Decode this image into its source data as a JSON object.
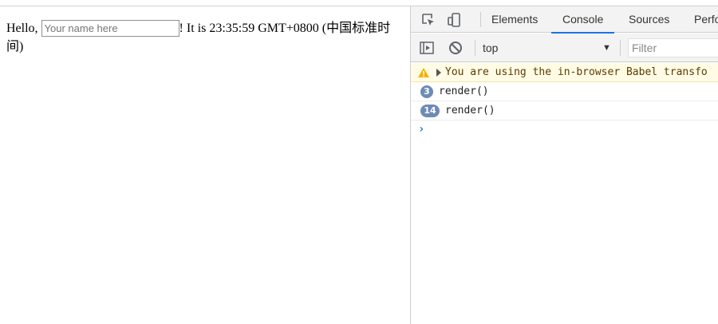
{
  "page": {
    "greeting_prefix": "Hello, ",
    "name_input_placeholder": "Your name here",
    "time_text": "! It is 23:35:59 GMT+0800 (中国标准时间)"
  },
  "devtools": {
    "tabs": [
      {
        "label": "Elements",
        "active": false
      },
      {
        "label": "Console",
        "active": true
      },
      {
        "label": "Sources",
        "active": false
      },
      {
        "label": "Perfo",
        "active": false
      }
    ],
    "toolbar": {
      "context": "top",
      "filter_placeholder": "Filter"
    },
    "console": {
      "warning": "You are using the in-browser Babel transfo",
      "logs": [
        {
          "count": "3",
          "text": "render()"
        },
        {
          "count": "14",
          "text": "render()"
        }
      ],
      "prompt": "›"
    },
    "colors": {
      "accent": "#1a73e8",
      "badge": "#6e8bb7",
      "warning_bg": "#fffbe5"
    }
  }
}
